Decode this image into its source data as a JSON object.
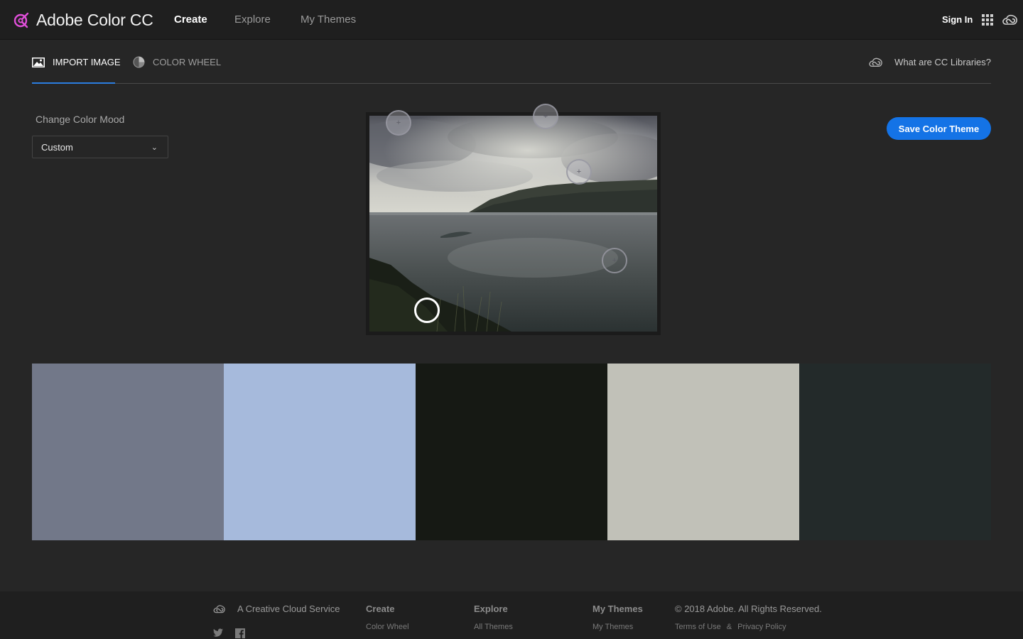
{
  "header": {
    "app_name": "Adobe Color CC",
    "nav": [
      {
        "label": "Create",
        "active": true
      },
      {
        "label": "Explore",
        "active": false
      },
      {
        "label": "My Themes",
        "active": false
      }
    ],
    "sign_in": "Sign In",
    "icons": [
      "adobe-color-logo-icon",
      "apps-grid-icon",
      "creative-cloud-icon"
    ]
  },
  "tabs": {
    "items": [
      {
        "label": "IMPORT IMAGE",
        "icon": "image-icon",
        "active": true
      },
      {
        "label": "COLOR WHEEL",
        "icon": "color-wheel-icon",
        "active": false
      }
    ],
    "cc_libraries": "What are CC Libraries?"
  },
  "mood": {
    "label": "Change Color Mood",
    "selected": "Custom"
  },
  "save_button": "Save Color Theme",
  "accent_color": "#1473e6",
  "swatches": [
    "#727889",
    "#a6badc",
    "#161914",
    "#c1c1b8",
    "#232a2a"
  ],
  "footer": {
    "tagline": "A Creative Cloud Service",
    "columns": [
      {
        "heading": "Create",
        "link": "Color Wheel"
      },
      {
        "heading": "Explore",
        "link": "All Themes"
      },
      {
        "heading": "My Themes",
        "link": "My Themes"
      }
    ],
    "copyright": "© 2018 Adobe. All Rights Reserved.",
    "terms": "Terms of Use",
    "amp": "&",
    "privacy": "Privacy Policy",
    "social": [
      "twitter-icon",
      "facebook-icon"
    ]
  }
}
